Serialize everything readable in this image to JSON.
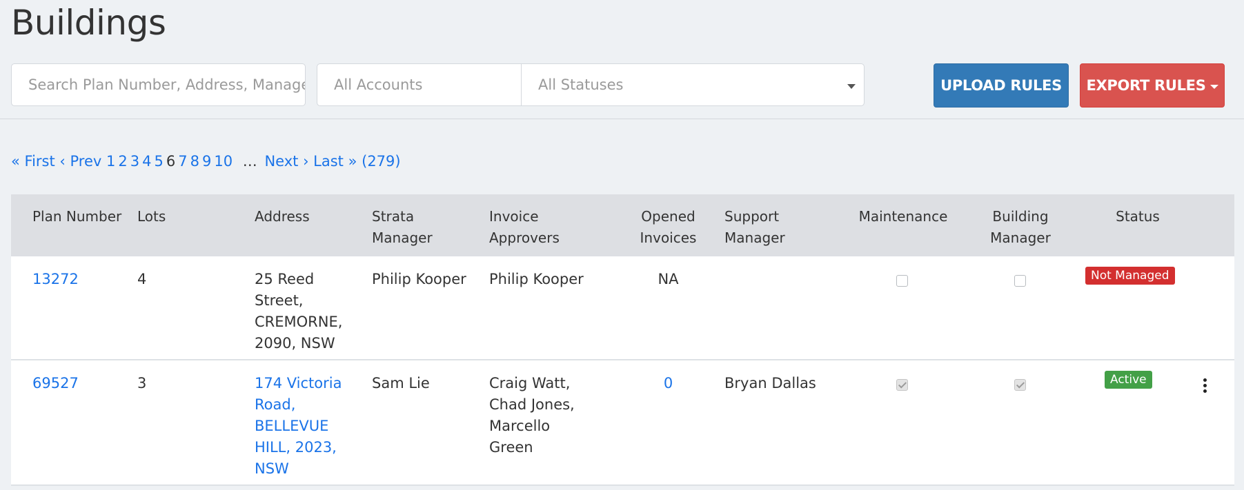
{
  "page": {
    "title": "Buildings"
  },
  "filters": {
    "search_placeholder": "Search Plan Number, Address, Manager",
    "accounts": "All Accounts",
    "statuses": "All Statuses"
  },
  "actions": {
    "upload_label": "UPLOAD RULES",
    "export_label": "EXPORT RULES"
  },
  "pagination": {
    "first": "« First",
    "prev": "‹ Prev",
    "pages": [
      "1",
      "2",
      "3",
      "4",
      "5",
      "6",
      "7",
      "8",
      "9",
      "10"
    ],
    "current": "6",
    "ellipsis": "…",
    "next": "Next ›",
    "last": "Last »",
    "total": "(279)"
  },
  "table": {
    "headers": {
      "plan": "Plan Number",
      "lots": "Lots",
      "address": "Address",
      "strata_1": "Strata",
      "strata_2": "Manager",
      "invoice_1": "Invoice",
      "invoice_2": "Approvers",
      "opened_1": "Opened",
      "opened_2": "Invoices",
      "support_1": "Support",
      "support_2": "Manager",
      "maintenance": "Maintenance",
      "building_1": "Building",
      "building_2": "Manager",
      "status": "Status"
    },
    "rows": [
      {
        "plan": "13272",
        "lots": "4",
        "address": [
          "25 Reed",
          "Street,",
          "CREMORNE,",
          "2090, NSW"
        ],
        "strata": "Philip Kooper",
        "approvers": [
          "Philip Kooper"
        ],
        "opened": "NA",
        "support": "",
        "maintenance": false,
        "building_manager": false,
        "status": "Not Managed",
        "status_color": "#d32f2f"
      },
      {
        "plan": "69527",
        "lots": "3",
        "address": [
          "174 Victoria",
          "Road,",
          "BELLEVUE",
          "HILL, 2023,",
          "NSW"
        ],
        "strata": "Sam Lie",
        "approvers": [
          "Craig Watt,",
          "Chad Jones,",
          "Marcello",
          "Green"
        ],
        "opened": "0",
        "support": "Bryan Dallas",
        "maintenance": true,
        "building_manager": true,
        "status": "Active",
        "status_color": "#43a047"
      }
    ]
  },
  "icons": {
    "more": "more-vertical-icon",
    "dropdown": "caret-down-icon"
  }
}
